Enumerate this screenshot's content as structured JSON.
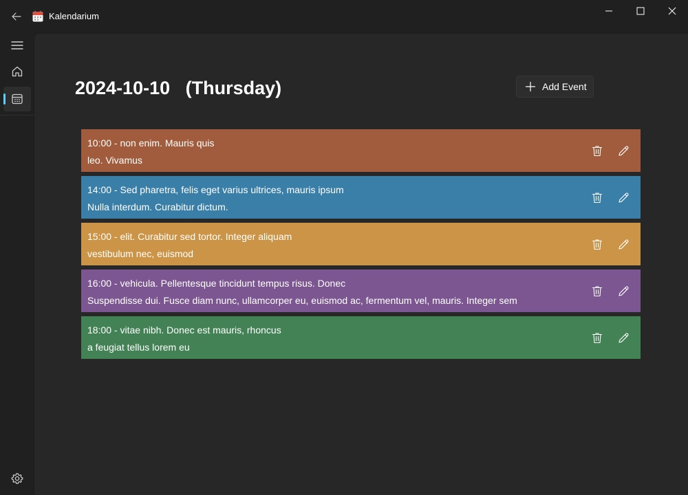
{
  "window": {
    "title": "Kalendarium",
    "icons": {
      "back": "back-arrow-icon",
      "app": "calendar-app-icon",
      "minimize": "minimize-icon",
      "maximize": "maximize-icon",
      "close": "close-icon"
    }
  },
  "nav": {
    "items": [
      {
        "name": "menu",
        "icon": "hamburger-menu-icon"
      },
      {
        "name": "home",
        "icon": "home-icon"
      },
      {
        "name": "calendar",
        "icon": "calendar-icon",
        "selected": true
      },
      {
        "name": "settings",
        "icon": "gear-icon"
      }
    ],
    "accent_color": "#60cdff"
  },
  "main": {
    "date_label": "2024-10-10   (Thursday)",
    "add_button_label": "Add Event",
    "events": [
      {
        "line1": "10:00 - non enim. Mauris quis",
        "line2": "leo. Vivamus",
        "color": "#a05c3c"
      },
      {
        "line1": "14:00 - Sed pharetra, felis eget varius ultrices, mauris ipsum",
        "line2": "Nulla interdum. Curabitur dictum.",
        "color": "#3a7fa8"
      },
      {
        "line1": "15:00 - elit. Curabitur sed tortor. Integer aliquam",
        "line2": "vestibulum nec, euismod",
        "color": "#cc9446"
      },
      {
        "line1": "16:00 - vehicula. Pellentesque tincidunt tempus risus. Donec",
        "line2": "Suspendisse dui. Fusce diam nunc, ullamcorper eu, euismod ac, fermentum vel, mauris. Integer sem",
        "color": "#7b5690"
      },
      {
        "line1": "18:00 - vitae nibh. Donec est mauris, rhoncus",
        "line2": "a feugiat tellus lorem eu",
        "color": "#438254"
      }
    ],
    "event_action_icons": {
      "delete": "trash-icon",
      "edit": "pencil-icon"
    }
  }
}
